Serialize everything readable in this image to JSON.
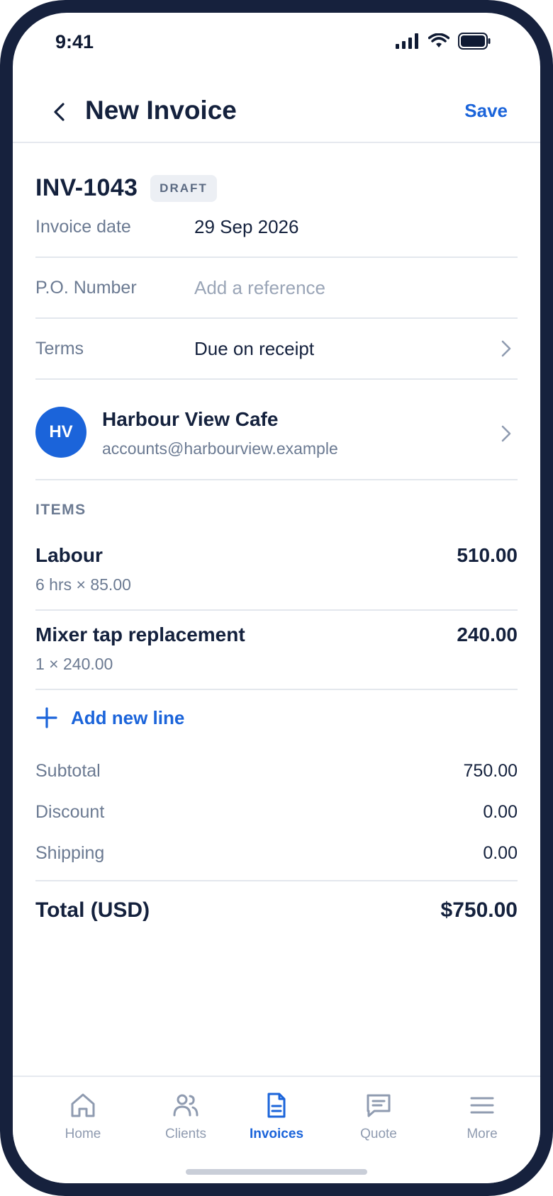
{
  "status_bar": {
    "time": "9:41"
  },
  "header": {
    "title": "New Invoice",
    "save_label": "Save"
  },
  "invoice": {
    "number": "INV-1043",
    "status_badge": "DRAFT",
    "fields": {
      "date_label": "Invoice date",
      "date_value": "29 Sep 2026",
      "po_label": "P.O. Number",
      "po_placeholder": "Add a reference",
      "terms_label": "Terms",
      "terms_value": "Due on receipt"
    },
    "client": {
      "initials": "HV",
      "name": "Harbour View Cafe",
      "email": "accounts@harbourview.example"
    }
  },
  "items": {
    "section_label": "ITEMS",
    "rows": [
      {
        "name": "Labour",
        "detail": "6 hrs × 85.00",
        "amount": "510.00"
      },
      {
        "name": "Mixer tap replacement",
        "detail": "1 × 240.00",
        "amount": "240.00"
      }
    ],
    "add_line_label": "Add new line"
  },
  "summary": {
    "subtotal_label": "Subtotal",
    "subtotal_value": "750.00",
    "discount_label": "Discount",
    "discount_value": "0.00",
    "shipping_label": "Shipping",
    "shipping_value": "0.00",
    "total_label": "Total (USD)",
    "total_value": "$750.00"
  },
  "nav": {
    "items": [
      {
        "label": "Home",
        "icon": "home-icon"
      },
      {
        "label": "Clients",
        "icon": "users-icon"
      },
      {
        "label": "Invoices",
        "icon": "document-icon"
      },
      {
        "label": "Quote",
        "icon": "chat-icon"
      },
      {
        "label": "More",
        "icon": "menu-icon"
      }
    ],
    "active": "Invoices"
  },
  "colors": {
    "accent": "#1b64da",
    "text": "#14213d",
    "muted": "#6b7a92",
    "frame": "#16213d"
  }
}
